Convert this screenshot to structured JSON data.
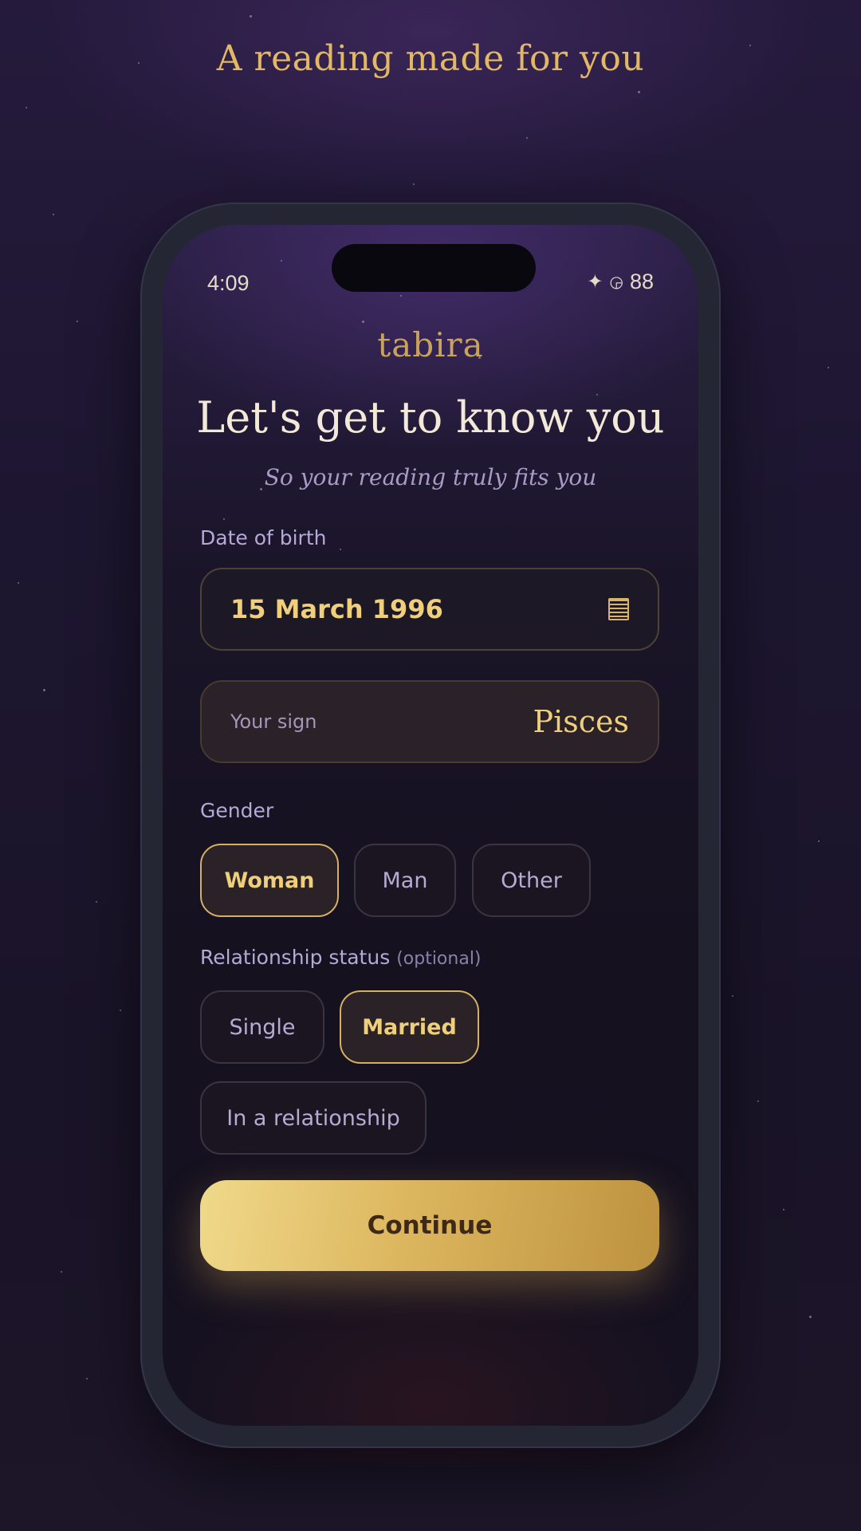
{
  "page": {
    "heading": "A reading made for you"
  },
  "status_bar": {
    "time": "4:09",
    "battery": "88",
    "icons": [
      "sparkle-icon",
      "signal-icon"
    ]
  },
  "app": {
    "brand": "tabira",
    "title": "Let's get to know you",
    "subtitle": "So your reading truly fits you"
  },
  "form": {
    "dob": {
      "label": "Date of birth",
      "value": "15 March 1996",
      "icon": "calendar-icon"
    },
    "sign": {
      "label": "Your sign",
      "value": "Pisces"
    },
    "gender": {
      "label": "Gender",
      "options": [
        "Woman",
        "Man",
        "Other"
      ],
      "selected": "Woman"
    },
    "relationship": {
      "label": "Relationship status",
      "optional_note": "(optional)",
      "options": [
        "Single",
        "Married",
        "In a relationship"
      ],
      "selected": "Married"
    },
    "continue_label": "Continue"
  },
  "colors": {
    "accent_gold": "#efcf7c",
    "background": "#1a1428",
    "muted_lavender": "#b5a9d6"
  }
}
